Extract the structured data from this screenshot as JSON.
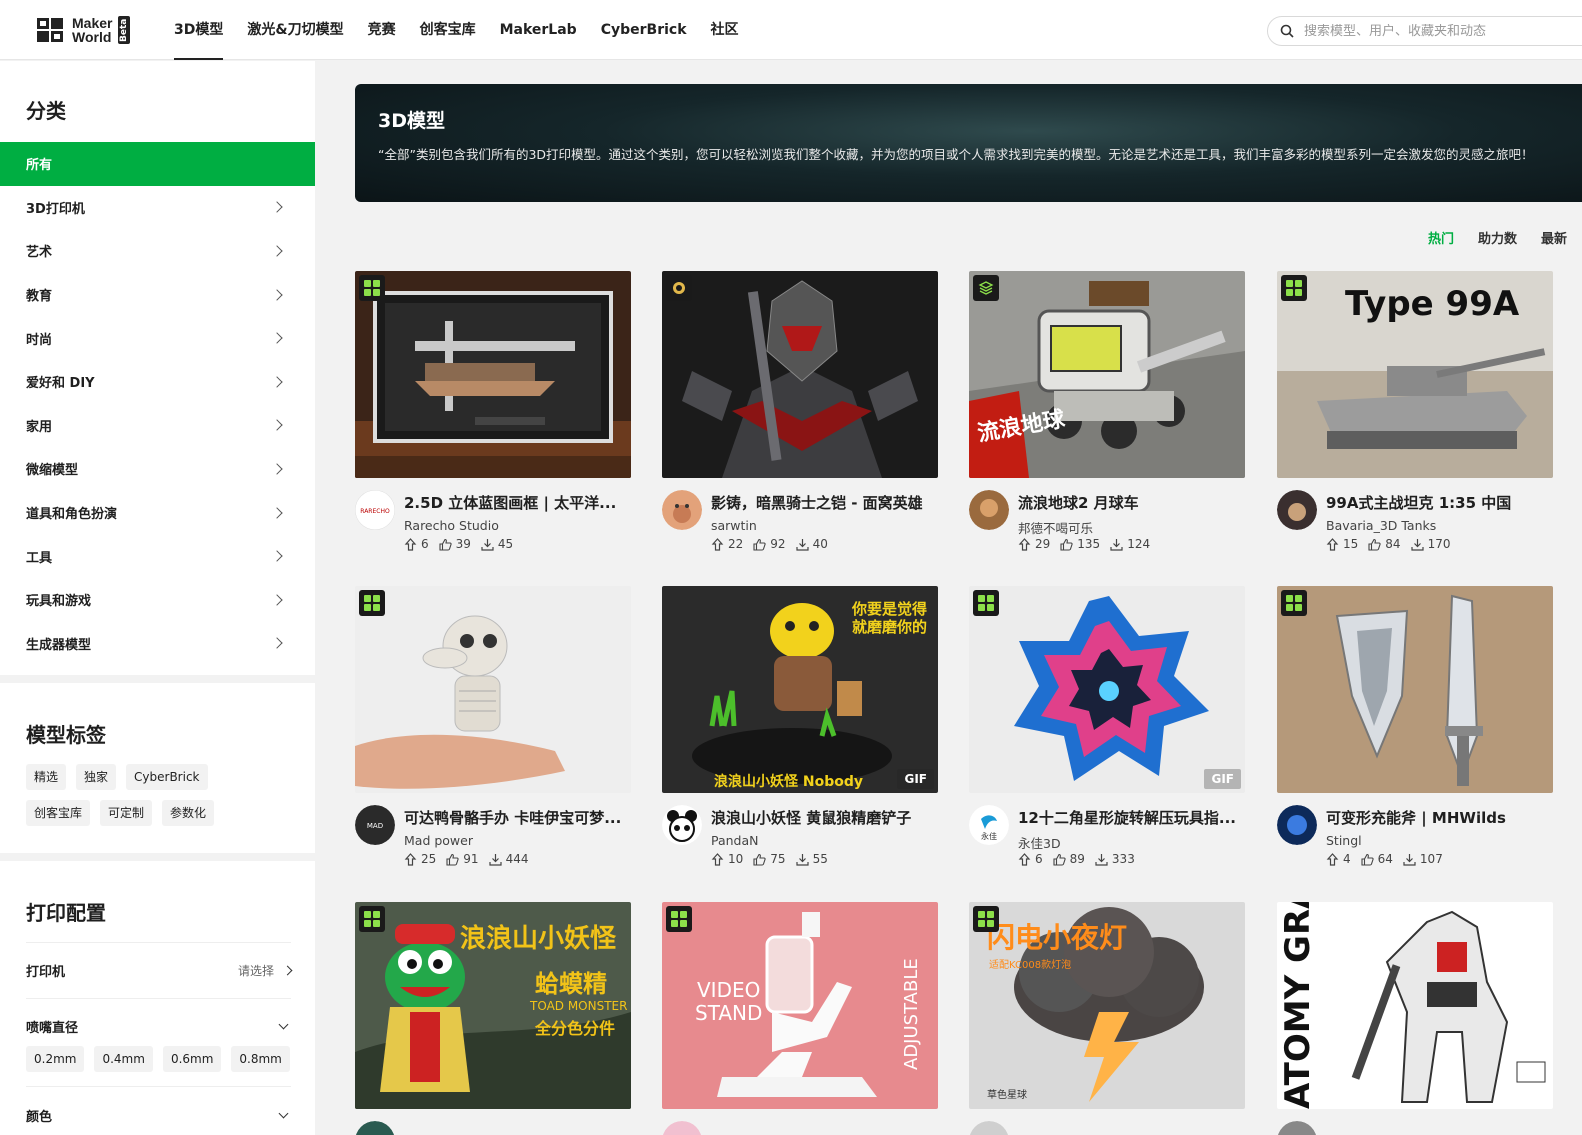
{
  "header": {
    "logo_line1": "Maker",
    "logo_line2": "World",
    "logo_beta": "Beta",
    "nav": [
      "3D模型",
      "激光&刀切模型",
      "竞赛",
      "创客宝库",
      "MakerLab",
      "CyberBrick",
      "社区"
    ],
    "search_placeholder": "搜索模型、用户、收藏夹和动态"
  },
  "sidebar": {
    "category_title": "分类",
    "categories": [
      "所有",
      "3D打印机",
      "艺术",
      "教育",
      "时尚",
      "爱好和 DIY",
      "家用",
      "微缩模型",
      "道具和角色扮演",
      "工具",
      "玩具和游戏",
      "生成器模型"
    ],
    "tags_title": "模型标签",
    "tags": [
      "精选",
      "独家",
      "CyberBrick",
      "创客宝库",
      "可定制",
      "参数化"
    ],
    "print_title": "打印配置",
    "printer_label": "打印机",
    "printer_value": "请选择",
    "nozzle_label": "喷嘴直径",
    "nozzles": [
      "0.2mm",
      "0.4mm",
      "0.6mm",
      "0.8mm"
    ],
    "color_label": "颜色"
  },
  "banner": {
    "title": "3D模型",
    "desc": "“全部”类别包含我们所有的3D打印模型。通过这个类别，您可以轻松浏览我们整个收藏，并为您的项目或个人需求找到完美的模型。无论是艺术还是工具，我们丰富多彩的模型系列一定会激发您的灵感之旅吧！"
  },
  "sort": [
    "热门",
    "助力数",
    "最新"
  ],
  "models": [
    {
      "title": "2.5D 立体蓝图画框 | 太平洋...",
      "author": "Rarecho Studio",
      "boosts": "6",
      "likes": "39",
      "downloads": "45",
      "gif": ""
    },
    {
      "title": "影铸，暗黑骑士之铠 - 面窝英雄",
      "author": "sarwtin",
      "boosts": "22",
      "likes": "92",
      "downloads": "40",
      "gif": ""
    },
    {
      "title": "流浪地球2 月球车",
      "author": "邦德不喝可乐",
      "boosts": "29",
      "likes": "135",
      "downloads": "124",
      "gif": ""
    },
    {
      "title": "99A式主战坦克 1:35 中国",
      "author": "Bavaria_3D Tanks",
      "boosts": "15",
      "likes": "84",
      "downloads": "170",
      "gif": ""
    },
    {
      "title": "可达鸭骨骼手办 卡哇伊宝可梦...",
      "author": "Mad power",
      "boosts": "25",
      "likes": "91",
      "downloads": "444",
      "gif": ""
    },
    {
      "title": "浪浪山小妖怪 黄鼠狼精磨铲子",
      "author": "PandaN",
      "boosts": "10",
      "likes": "75",
      "downloads": "55",
      "gif": "GIF"
    },
    {
      "title": "12十二角星形旋转解压玩具指...",
      "author": "永佳3D",
      "boosts": "6",
      "likes": "89",
      "downloads": "333",
      "gif": "GIF"
    },
    {
      "title": "可变形充能斧 | MHWilds",
      "author": "Stingl",
      "boosts": "4",
      "likes": "64",
      "downloads": "107",
      "gif": ""
    },
    {
      "title": "",
      "author": "",
      "boosts": "",
      "likes": "",
      "downloads": "",
      "gif": ""
    },
    {
      "title": "",
      "author": "",
      "boosts": "",
      "likes": "",
      "downloads": "",
      "gif": ""
    },
    {
      "title": "",
      "author": "",
      "boosts": "",
      "likes": "",
      "downloads": "",
      "gif": ""
    },
    {
      "title": "",
      "author": "",
      "boosts": "",
      "likes": "",
      "downloads": "",
      "gif": ""
    }
  ],
  "image_text": {
    "tank_label": "Type 99A",
    "rover_label": "流浪地球",
    "weasel_text": "你要是觉得就磨磨你的",
    "weasel_caption": "浪浪山小妖怪 Nobody",
    "toad_title": "浪浪山小妖怪",
    "toad_name": "蛤蟆精",
    "toad_en": "TOAD MONSTER",
    "toad_sub": "全分色分件",
    "stand_text": "VIDEO STAND",
    "stand_side": "ADJUSTABLE",
    "lamp_title": "闪电小夜灯",
    "lamp_sub": "适配KC008款灯泡",
    "lamp_brand": "草色星球",
    "gundam_text": "ATOMY GRADE M"
  },
  "colors": {
    "accent": "#00ae42",
    "badge_green": "#8ce04a"
  }
}
